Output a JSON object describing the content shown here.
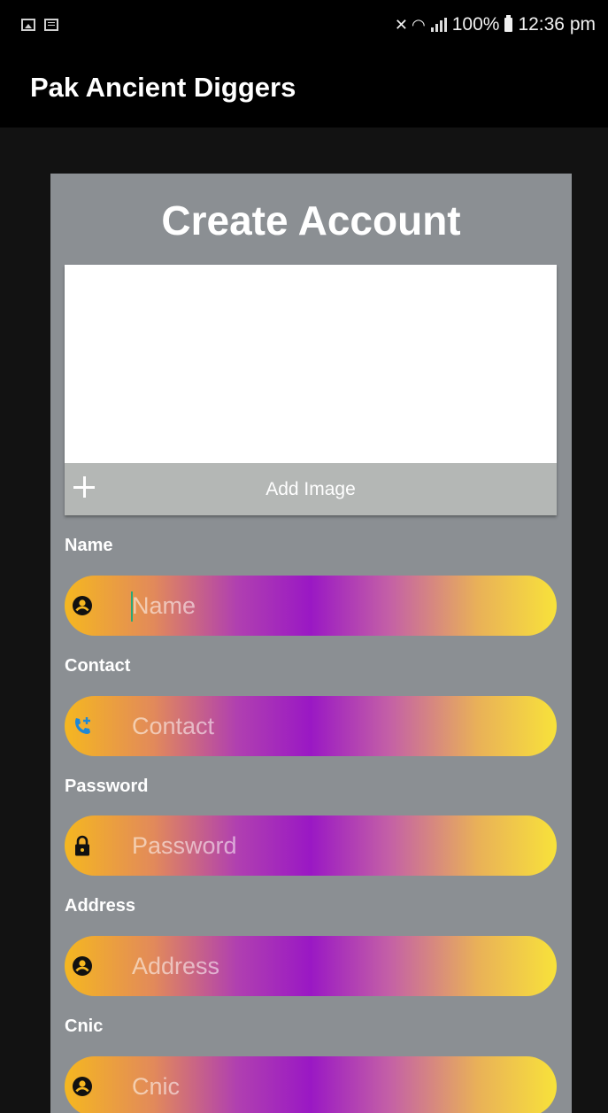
{
  "status_bar": {
    "battery": "100%",
    "time": "12:36 pm"
  },
  "app_bar": {
    "title": "Pak Ancient Diggers"
  },
  "form": {
    "title": "Create Account",
    "add_image_label": "Add Image",
    "fields": [
      {
        "label": "Name",
        "placeholder": "Name",
        "value": "",
        "icon": "person-icon"
      },
      {
        "label": "Contact",
        "placeholder": "Contact",
        "value": "",
        "icon": "add-call-icon"
      },
      {
        "label": "Password",
        "placeholder": "Password",
        "value": "",
        "icon": "lock-icon"
      },
      {
        "label": "Address",
        "placeholder": "Address",
        "value": "",
        "icon": "person-icon"
      },
      {
        "label": "Cnic",
        "placeholder": "Cnic",
        "value": "",
        "icon": "person-icon"
      }
    ]
  },
  "colors": {
    "card_background": "#8b8f93",
    "app_bar": "#000000",
    "gradient_start": "#f5b720",
    "gradient_mid": "#9a18c4",
    "gradient_end": "#f8e23a",
    "icon_blue": "#1e88d6"
  }
}
